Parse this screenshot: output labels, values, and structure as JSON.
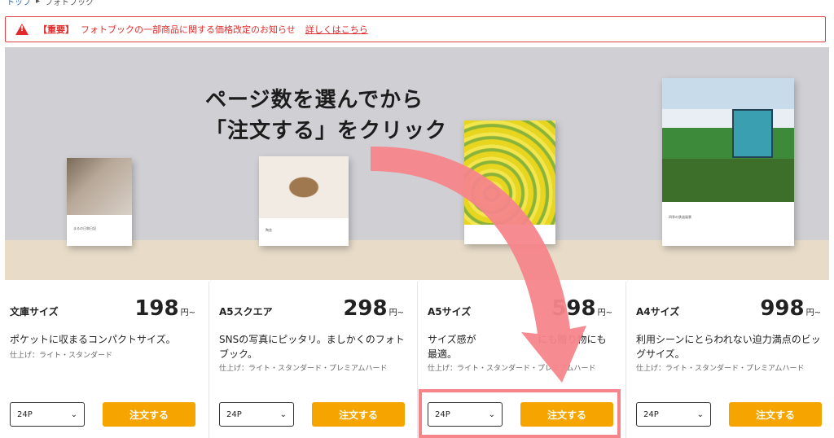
{
  "breadcrumb": {
    "home": "トップ",
    "current": "フォトブック"
  },
  "notice": {
    "tag": "【重要】",
    "message": "フォトブックの一部商品に関する価格改定のお知らせ",
    "link": "詳しくはこちら",
    "icon": "warning-icon"
  },
  "hero": {
    "line1": "ページ数を選んでから",
    "line2": "「注文する」をクリック",
    "books": [
      {
        "caption": "まるの日和日記"
      },
      {
        "caption": "陶芸"
      },
      {
        "caption": ""
      },
      {
        "caption": "四季の鉄道風景"
      }
    ]
  },
  "cards": [
    {
      "name": "文庫サイズ",
      "price": "198",
      "yen": "円~",
      "desc": "ポケットに収まるコンパクトサイズ。",
      "finish": "仕上げ：ライト・スタンダード",
      "pages": "24P",
      "order": "注文する"
    },
    {
      "name": "A5スクエア",
      "price": "298",
      "yen": "円~",
      "desc": "SNSの写真にピッタリ。ましかくのフォトブック。",
      "finish": "仕上げ：ライト・スタンダード・プレミアムハード",
      "pages": "24P",
      "order": "注文する"
    },
    {
      "name": "A5サイズ",
      "price": "598",
      "yen": "円~",
      "desc": "サイズ感が 　　　　　　にも贈り物にも最適。",
      "finish": "仕上げ：ライト・スタンダード・プレミアムハード",
      "pages": "24P",
      "order": "注文する"
    },
    {
      "name": "A4サイズ",
      "price": "998",
      "yen": "円~",
      "desc": "利用シーンにとらわれない迫力満点のビッグサイズ。",
      "finish": "仕上げ：ライト・スタンダード・プレミアムハード",
      "pages": "24P",
      "order": "注文する"
    }
  ],
  "colors": {
    "accent": "#f6a500",
    "alert": "#e02b2b",
    "arrow": "#f6858b"
  }
}
